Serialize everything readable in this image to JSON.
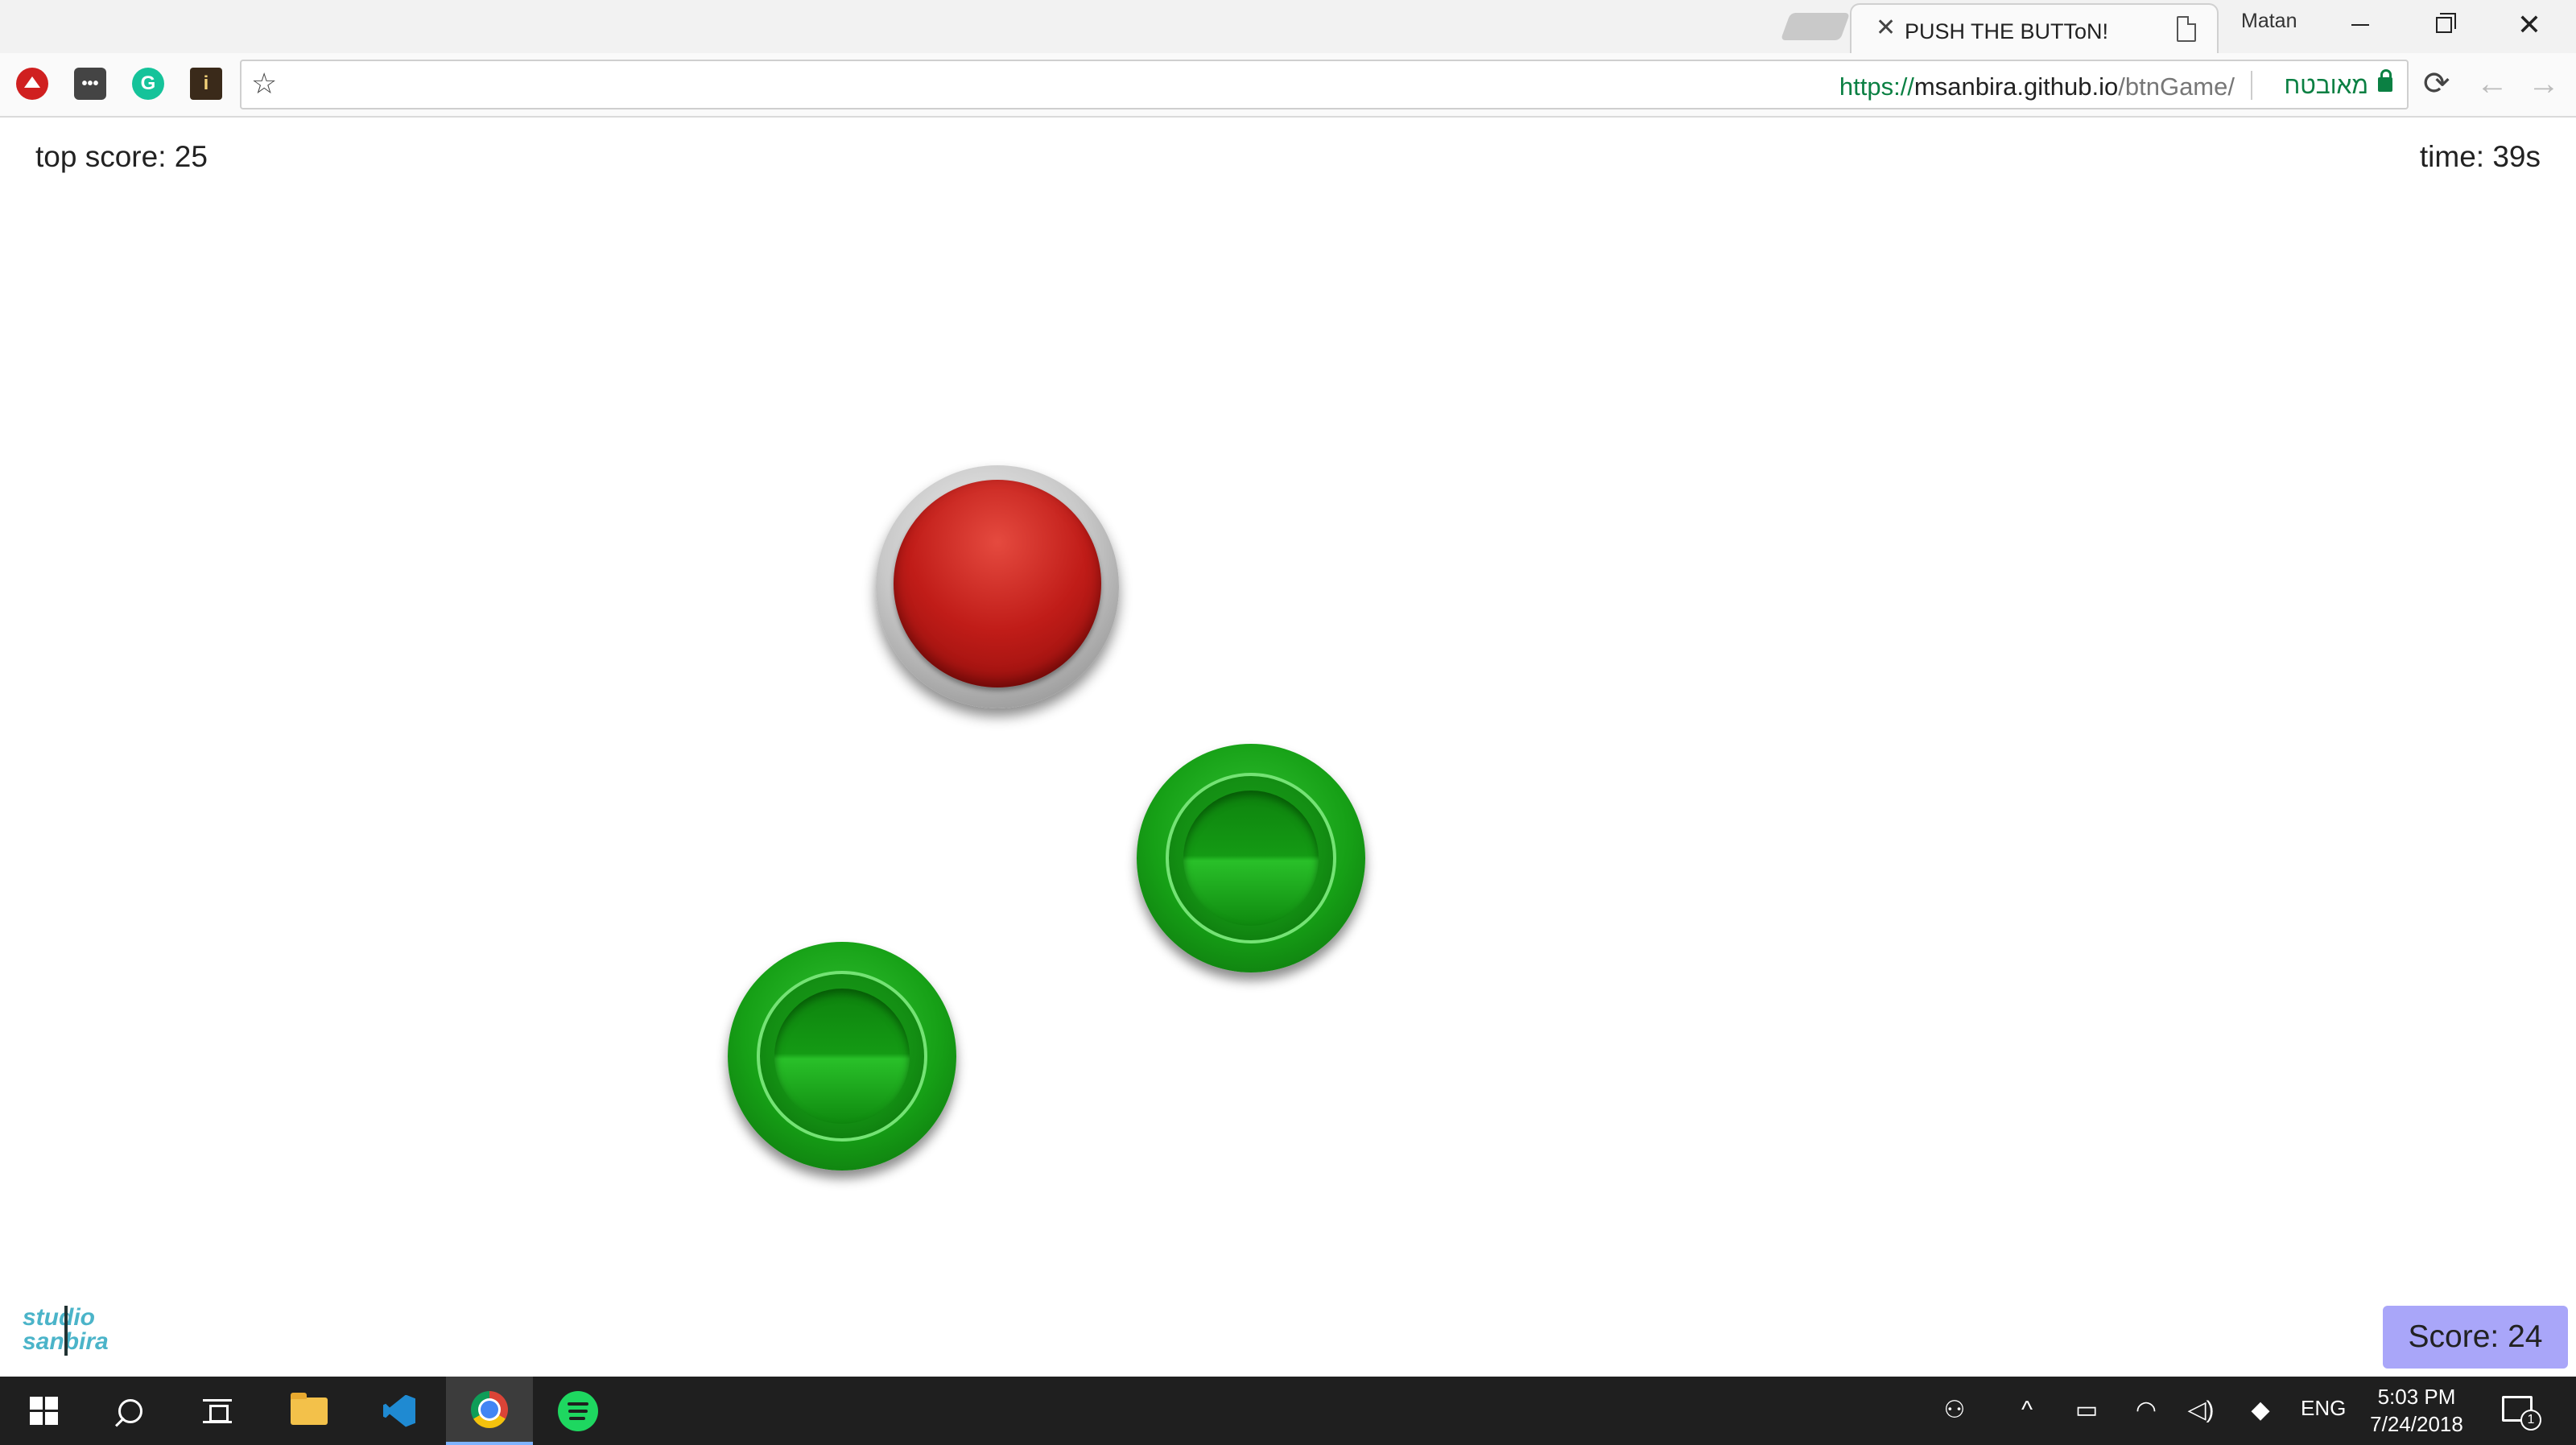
{
  "browser": {
    "tab_title": "PUSH THE BUTToN!",
    "profile_name": "Matan",
    "url_scheme": "https://",
    "url_host": "msanbira.github.io",
    "url_path": "/btnGame/",
    "security_label": "מאובטח"
  },
  "game": {
    "top_score_text": "top score: 25",
    "time_text": "time: 39s",
    "score_text": "Score: 24",
    "buttons": [
      {
        "color": "red",
        "hex": "#c01c18"
      },
      {
        "color": "green",
        "hex": "#16a016"
      },
      {
        "color": "green",
        "hex": "#16a016"
      }
    ],
    "score_box_color": "#a9a6f9",
    "logo_text_line1": "studio",
    "logo_text_line2": "sanbira"
  },
  "taskbar": {
    "apps": [
      "start-icon",
      "search-icon",
      "task-view-icon",
      "file-explorer-icon",
      "vscode-icon",
      "chrome-icon",
      "spotify-icon"
    ],
    "language": "ENG",
    "time": "5:03 PM",
    "date": "7/24/2018",
    "notification_count": "1"
  }
}
